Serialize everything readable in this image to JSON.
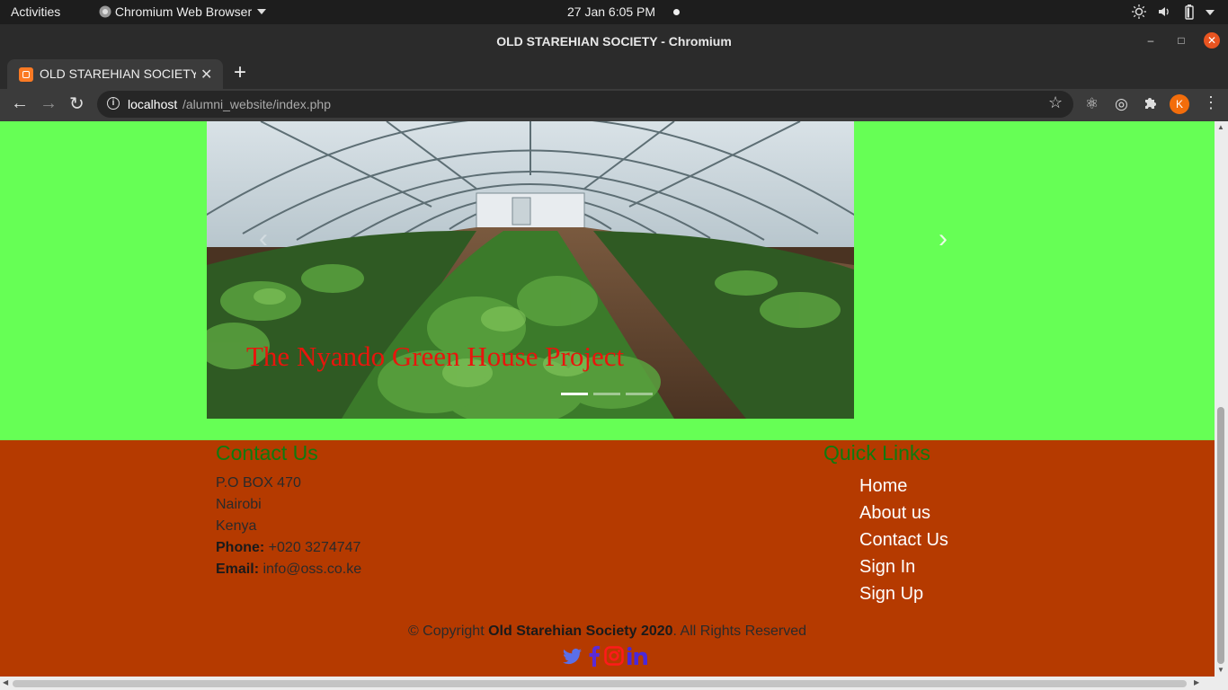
{
  "os_bar": {
    "activities": "Activities",
    "app_menu": "Chromium Web Browser",
    "clock": "27 Jan  6:05 PM"
  },
  "window": {
    "title": "OLD STAREHIAN SOCIETY - Chromium"
  },
  "tab": {
    "title": "OLD STAREHIAN SOCIETY"
  },
  "address_bar": {
    "host": "localhost",
    "path": "/alumni_website/index.php"
  },
  "profile": {
    "initial": "K",
    "color": "#f36d0b"
  },
  "carousel": {
    "caption": "The Nyando Green House Project",
    "slide_count": 3,
    "active_index": 0
  },
  "contact": {
    "heading": "Contact Us",
    "address_lines": [
      "P.O BOX 470",
      "Nairobi",
      "Kenya"
    ],
    "phone_label": "Phone:",
    "phone": "+020 3274747",
    "email_label": "Email:",
    "email": "info@oss.co.ke"
  },
  "quick_links": {
    "heading": "Quick Links",
    "items": [
      "Home",
      "About us",
      "Contact Us",
      "Sign In",
      "Sign Up"
    ]
  },
  "copyright": {
    "prefix": "© Copyright",
    "org": "Old Starehian Society 2020",
    "suffix": ". All Rights Reserved"
  },
  "colors": {
    "page_background": "#66ff55",
    "footer_background": "#b53a00",
    "heading_green": "#0f7a0f",
    "caption_red": "#e8150c"
  }
}
